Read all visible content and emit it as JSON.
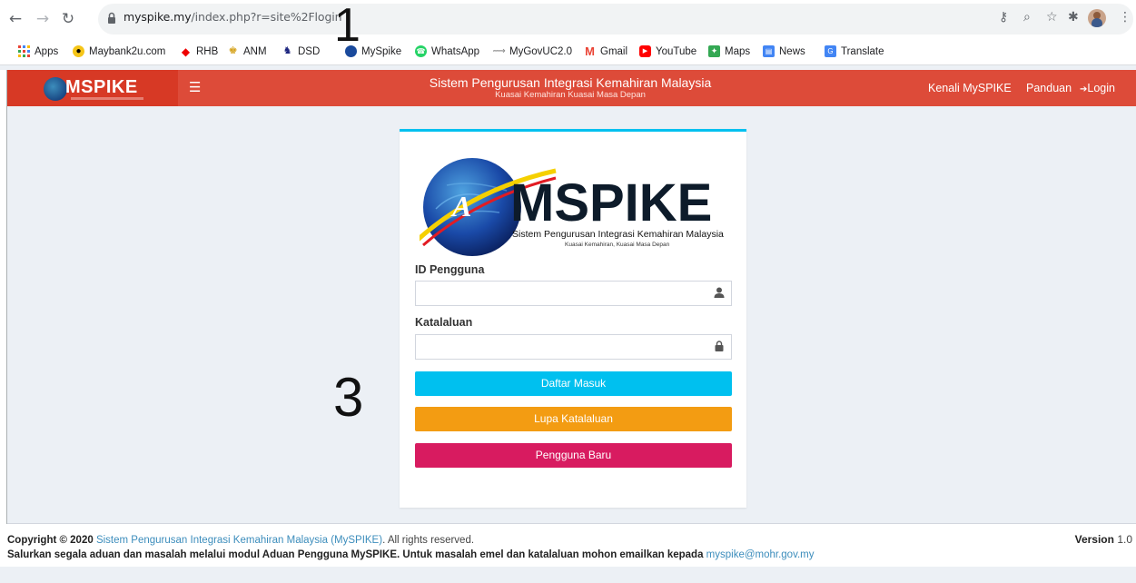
{
  "browser": {
    "url_host": "myspike.my",
    "url_path": "/index.php?r=site%2Flogin",
    "bookmarks": [
      {
        "label": "Apps",
        "icon": "apps-grid-icon"
      },
      {
        "label": "Maybank2u.com",
        "icon": "maybank-icon"
      },
      {
        "label": "RHB",
        "icon": "rhb-icon"
      },
      {
        "label": "ANM",
        "icon": "anm-icon"
      },
      {
        "label": "DSD",
        "icon": "dsd-icon"
      },
      {
        "label": "MySpike",
        "icon": "myspike-icon"
      },
      {
        "label": "WhatsApp",
        "icon": "whatsapp-icon"
      },
      {
        "label": "MyGovUC2.0",
        "icon": "mygovuc-icon"
      },
      {
        "label": "Gmail",
        "icon": "gmail-icon"
      },
      {
        "label": "YouTube",
        "icon": "youtube-icon"
      },
      {
        "label": "Maps",
        "icon": "maps-icon"
      },
      {
        "label": "News",
        "icon": "news-icon"
      },
      {
        "label": "Translate",
        "icon": "translate-icon"
      }
    ]
  },
  "annotations": {
    "one": "1",
    "three": "3"
  },
  "header": {
    "logo_text": "MSPIKE",
    "title": "Sistem Pengurusan Integrasi Kemahiran Malaysia",
    "subtitle": "Kuasai Kemahiran Kuasai Masa Depan",
    "links": {
      "kenali": "Kenali MySPIKE",
      "panduan": "Panduan",
      "login": "Login"
    }
  },
  "login": {
    "logo_word": "MSPIKE",
    "logo_caption": "Sistem Pengurusan Integrasi Kemahiran Malaysia",
    "logo_tagline": "Kuasai Kemahiran, Kuasai Masa Depan",
    "username_label": "ID Pengguna",
    "username_value": "",
    "password_label": "Katalaluan",
    "password_value": "",
    "buttons": {
      "sign_in": "Daftar Masuk",
      "forgot": "Lupa Katalaluan",
      "new_user": "Pengguna Baru"
    }
  },
  "footer": {
    "copyright_prefix": "Copyright © 2020",
    "system_name": "Sistem Pengurusan Integrasi Kemahiran Malaysia (MySPIKE)",
    "rights": ". All rights reserved.",
    "line2": "Salurkan segala aduan dan masalah melalui modul Aduan Pengguna MySPIKE. Untuk masalah emel dan katalaluan mohon emailkan kepada",
    "email": "myspike@mohr.gov.my",
    "version_label": "Version",
    "version_number": "1.0"
  },
  "colors": {
    "header_red": "#dd4b39",
    "sign_in_blue": "#00c0ef",
    "forgot_orange": "#f39c12",
    "new_user_pink": "#d81b60",
    "link_blue": "#3c8dbc"
  }
}
